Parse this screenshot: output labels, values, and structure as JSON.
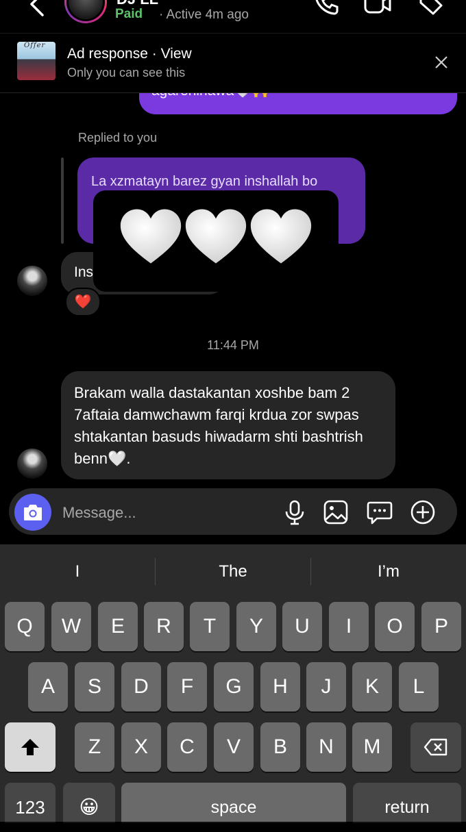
{
  "header": {
    "name": "DJ’LL",
    "status_paid": "Paid",
    "status_active": "· Active 4m ago"
  },
  "banner": {
    "title": "Ad response · View",
    "subtitle": "Only you can see this",
    "thumb_text": "Offer"
  },
  "chat": {
    "partial_sent_text": "agarehinawa🤍🙌",
    "replied_label": "Replied to you",
    "reply_text": "La xzmatayn barez gyan inshallah bo",
    "ins_text": "Ins",
    "reaction": "❤️",
    "hearts": [
      "🤍",
      "🤍",
      "🤍"
    ],
    "timestamp": "11:44 PM",
    "message": "Brakam walla dastakantan xoshbe bam 2 7aftaia damwchawm farqi krdua zor swpas shtakantan basuds hiwadarm shti bashtrish benn🤍."
  },
  "composer": {
    "placeholder": "Message..."
  },
  "keyboard": {
    "suggestions": [
      "I",
      "The",
      "I’m"
    ],
    "row1": [
      "Q",
      "W",
      "E",
      "R",
      "T",
      "Y",
      "U",
      "I",
      "O",
      "P"
    ],
    "row2": [
      "A",
      "S",
      "D",
      "F",
      "G",
      "H",
      "J",
      "K",
      "L"
    ],
    "row3": [
      "Z",
      "X",
      "C",
      "V",
      "B",
      "N",
      "M"
    ],
    "numbers_label": "123",
    "space_label": "space",
    "return_label": "return",
    "emoji": "😀"
  }
}
